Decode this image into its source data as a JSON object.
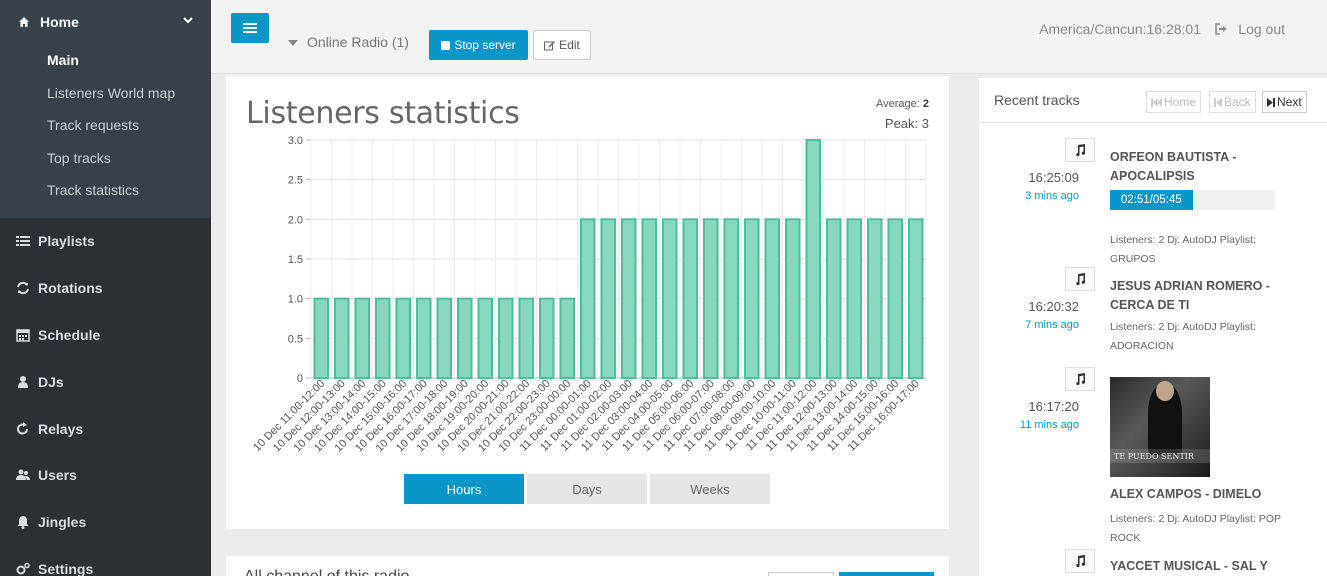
{
  "sidebar": {
    "home_label": "Home",
    "sub_items": [
      "Main",
      "Listeners World map",
      "Track requests",
      "Top tracks",
      "Track statistics"
    ],
    "items": [
      {
        "label": "Playlists",
        "icon": "list-icon"
      },
      {
        "label": "Rotations",
        "icon": "refresh-icon"
      },
      {
        "label": "Schedule",
        "icon": "calendar-icon"
      },
      {
        "label": "DJs",
        "icon": "user-icon"
      },
      {
        "label": "Relays",
        "icon": "rotate-icon"
      },
      {
        "label": "Users",
        "icon": "users-icon"
      },
      {
        "label": "Jingles",
        "icon": "bell-icon"
      },
      {
        "label": "Settings",
        "icon": "cogs-icon"
      }
    ]
  },
  "topbar": {
    "station": "Online Radio (1)",
    "stop_label": "Stop server",
    "edit_label": "Edit",
    "timezone": "America/Cancun:16:28:01",
    "logout_label": "Log out"
  },
  "stats": {
    "title": "Listeners statistics",
    "average_label": "Average:",
    "average_value": "2",
    "peak_label": "Peak: 3",
    "range_buttons": [
      "Hours",
      "Days",
      "Weeks"
    ],
    "active_range": "Hours"
  },
  "stats2": {
    "title": "All channel of this radio"
  },
  "chart_data": {
    "type": "bar",
    "title": "Listeners statistics",
    "xlabel": "",
    "ylabel": "",
    "ylim": [
      0,
      3
    ],
    "yticks": [
      "0",
      "0.5",
      "1.0",
      "1.5",
      "2.0",
      "2.5",
      "3.0"
    ],
    "grid": true,
    "colors": {
      "fill": "#88d8c0",
      "stroke": "#4dbd9d"
    },
    "categories": [
      "10 Dec 11:00-12:00",
      "10 Dec 12:00-13:00",
      "10 Dec 13:00-14:00",
      "10 Dec 14:00-15:00",
      "10 Dec 15:00-16:00",
      "10 Dec 16:00-17:00",
      "10 Dec 17:00-18:00",
      "10 Dec 18:00-19:00",
      "10 Dec 19:00-20:00",
      "10 Dec 20:00-21:00",
      "10 Dec 21:00-22:00",
      "10 Dec 22:00-23:00",
      "10 Dec 23:00-00:00",
      "11 Dec 00:00-01:00",
      "11 Dec 01:00-02:00",
      "11 Dec 02:00-03:00",
      "11 Dec 03:00-04:00",
      "11 Dec 04:00-05:00",
      "11 Dec 05:00-06:00",
      "11 Dec 06:00-07:00",
      "11 Dec 07:00-08:00",
      "11 Dec 08:00-09:00",
      "11 Dec 09:00-10:00",
      "11 Dec 10:00-11:00",
      "11 Dec 11:00-12:00",
      "11 Dec 12:00-13:00",
      "11 Dec 13:00-14:00",
      "11 Dec 14:00-15:00",
      "11 Dec 15:00-16:00",
      "11 Dec 16:00-17:00"
    ],
    "values": [
      1,
      1,
      1,
      1,
      1,
      1,
      1,
      1,
      1,
      1,
      1,
      1,
      1,
      2,
      2,
      2,
      2,
      2,
      2,
      2,
      2,
      2,
      2,
      2,
      3,
      2,
      2,
      2,
      2,
      2
    ]
  },
  "recent": {
    "title": "Recent tracks",
    "nav": {
      "home": "Home",
      "back": "Back",
      "next": "Next"
    },
    "tracks": [
      {
        "time": "16:25:09",
        "ago": "3 mins ago",
        "title": "ORFEON BAUTISTA - APOCALIPSIS",
        "progress": "02:51/05:45",
        "progress_fraction": 0.5,
        "info": "Listeners: 2 Dj: AutoDJ Playlist: GRUPOS"
      },
      {
        "time": "16:20:32",
        "ago": "7 mins ago",
        "title": "JESUS ADRIAN ROMERO - CERCA DE TI",
        "info": "Listeners: 2 Dj: AutoDJ Playlist: ADORACION"
      },
      {
        "time": "16:17:20",
        "ago": "11 mins ago",
        "title": "ALEX CAMPOS - DIMELO",
        "info": "Listeners: 2 Dj: AutoDJ Playlist: POP ROCK",
        "cover_text": "TE PUEDO SENTIR"
      },
      {
        "title": "YACCET MUSICAL - SAL Y"
      }
    ]
  }
}
